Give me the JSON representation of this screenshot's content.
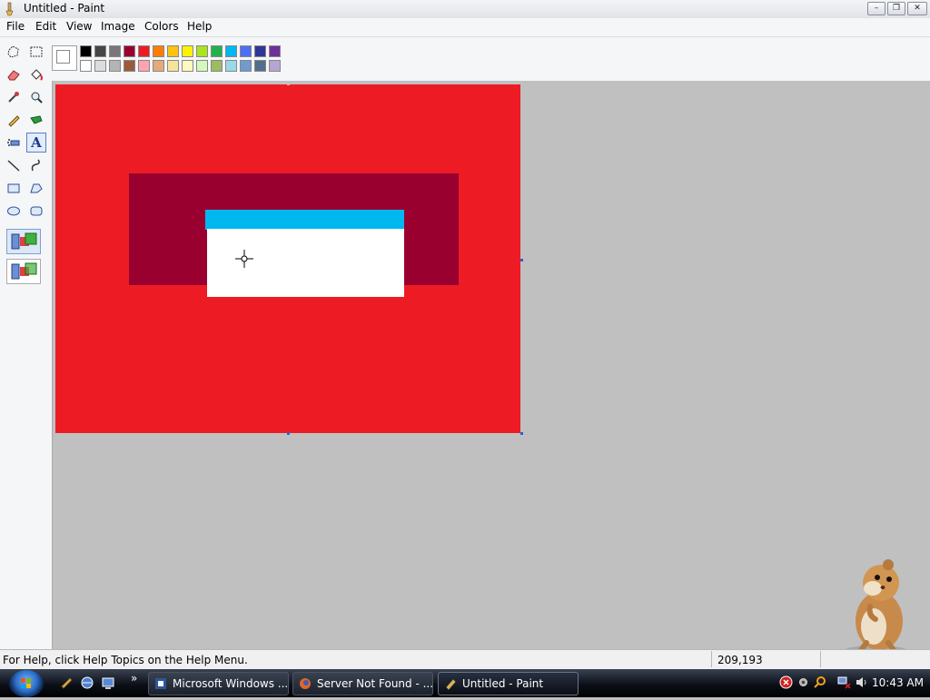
{
  "window": {
    "title": "Untitled - Paint",
    "controls": {
      "minimize": "–",
      "maximize": "❐",
      "close": "✕"
    }
  },
  "menu": [
    "File",
    "Edit",
    "View",
    "Image",
    "Colors",
    "Help"
  ],
  "tools": [
    {
      "name": "free-form-select-icon"
    },
    {
      "name": "select-icon"
    },
    {
      "name": "eraser-icon"
    },
    {
      "name": "fill-icon"
    },
    {
      "name": "pick-color-icon"
    },
    {
      "name": "magnifier-icon"
    },
    {
      "name": "pencil-icon"
    },
    {
      "name": "brush-icon"
    },
    {
      "name": "airbrush-icon"
    },
    {
      "name": "text-icon",
      "active": true
    },
    {
      "name": "line-icon"
    },
    {
      "name": "curve-icon"
    },
    {
      "name": "rectangle-icon"
    },
    {
      "name": "polygon-icon"
    },
    {
      "name": "ellipse-icon"
    },
    {
      "name": "rounded-rectangle-icon"
    }
  ],
  "text_tool_glyph": "A",
  "palette": {
    "top": [
      "#000000",
      "#464646",
      "#787878",
      "#990030",
      "#ed1c24",
      "#ff7e00",
      "#ffc20e",
      "#fff200",
      "#a8e61d",
      "#22b14c",
      "#00b7ef",
      "#4d6df3",
      "#2f3699",
      "#6f3198"
    ],
    "bottom": [
      "#ffffff",
      "#dcdcdc",
      "#b4b4b4",
      "#9c5a3c",
      "#ffa3b1",
      "#e5aa7a",
      "#f5e49c",
      "#fff9bd",
      "#d3f9bc",
      "#9dbb61",
      "#99d9ea",
      "#709ad1",
      "#546d8e",
      "#b5a5d5"
    ]
  },
  "canvas": {
    "background": "#ed1c24",
    "shapes": [
      {
        "name": "dark-red-rectangle",
        "color": "#990030"
      },
      {
        "name": "cyan-bar",
        "color": "#00b7ef"
      },
      {
        "name": "white-rectangle",
        "color": "#ffffff"
      }
    ]
  },
  "status": {
    "help_text": "For Help, click Help Topics on the Help Menu.",
    "coordinates": "209,193"
  },
  "taskbar": {
    "overflow_chevron": "»",
    "buttons": [
      {
        "label": "Microsoft Windows ...",
        "icon": "word-icon"
      },
      {
        "label": "Server Not Found - ...",
        "icon": "firefox-icon"
      },
      {
        "label": "Untitled - Paint",
        "icon": "paint-icon",
        "active": true
      }
    ],
    "clock": "10:43 AM"
  }
}
